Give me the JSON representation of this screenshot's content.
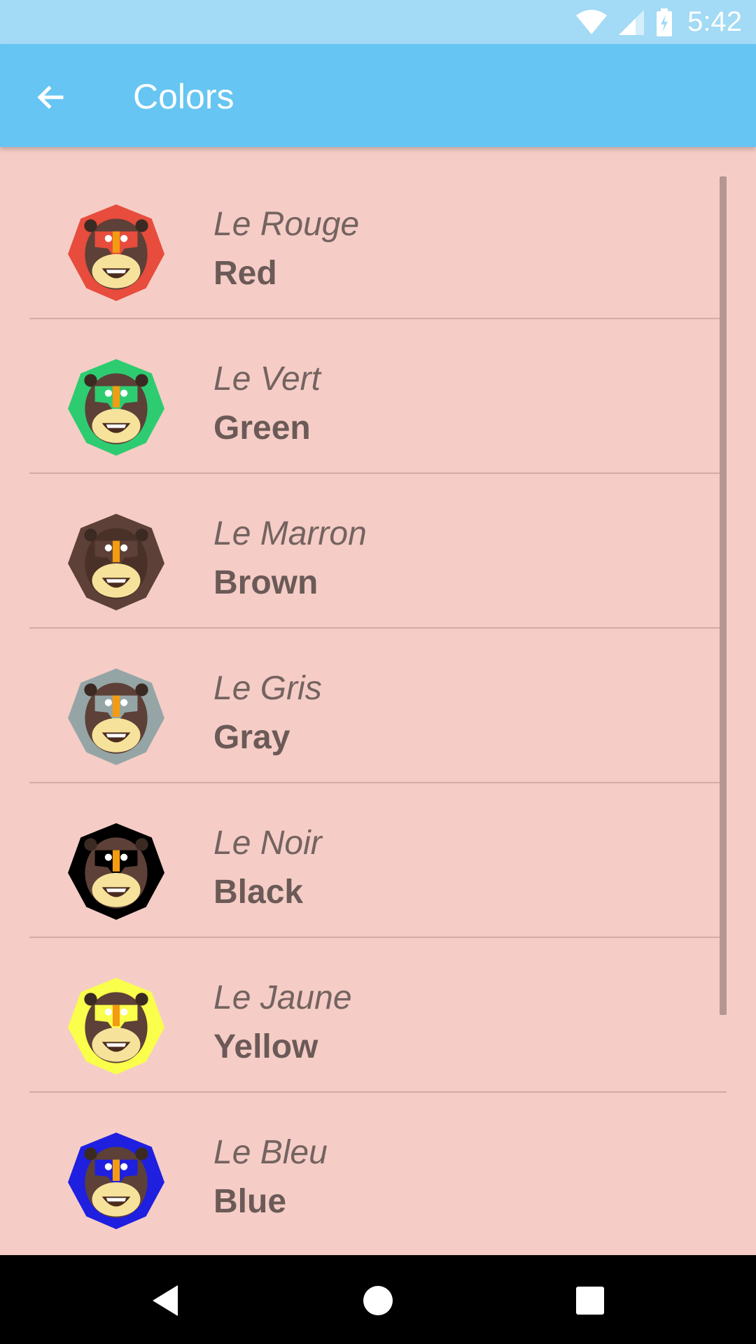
{
  "status_bar": {
    "time": "5:42",
    "icons": [
      "wifi-icon",
      "cell-signal-icon",
      "battery-charging-icon"
    ],
    "background": "#a3daf5"
  },
  "app_bar": {
    "title": "Colors",
    "back_icon": "arrow-back-icon",
    "background": "#66c5f2"
  },
  "colors": [
    {
      "french": "Le Rouge",
      "english": "Red",
      "swatch": "#e74c3c"
    },
    {
      "french": "Le Vert",
      "english": "Green",
      "swatch": "#2ecc71"
    },
    {
      "french": "Le Marron",
      "english": "Brown",
      "swatch": "#5d4037"
    },
    {
      "french": "Le Gris",
      "english": "Gray",
      "swatch": "#95a5a6"
    },
    {
      "french": "Le Noir",
      "english": "Black",
      "swatch": "#000000"
    },
    {
      "french": "Le Jaune",
      "english": "Yellow",
      "swatch": "#f9ff4a"
    },
    {
      "french": "Le Bleu",
      "english": "Blue",
      "swatch": "#1f1fe0"
    }
  ],
  "nav_bar": {
    "icons": [
      "nav-back-icon",
      "nav-home-icon",
      "nav-recents-icon"
    ]
  },
  "theme": {
    "page_background": "#f5cdc6",
    "text_color": "#6b5a57"
  }
}
